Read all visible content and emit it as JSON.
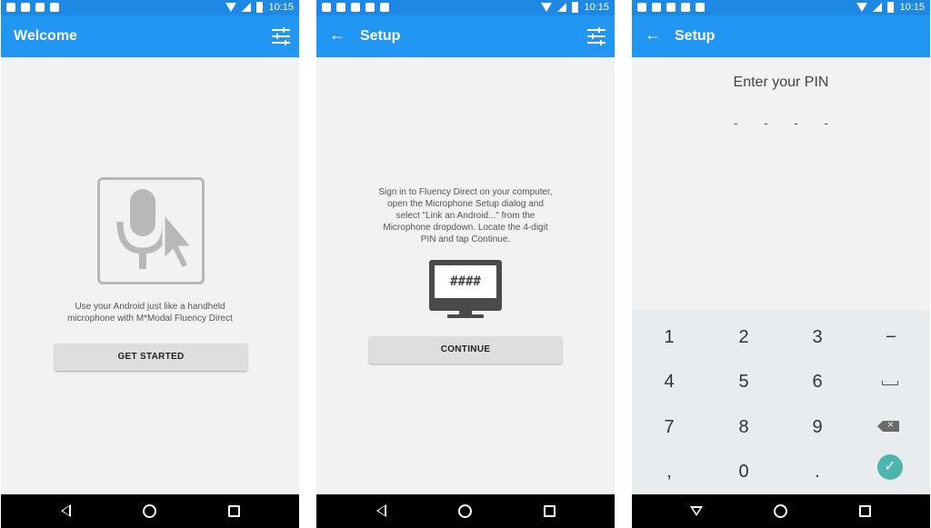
{
  "status_bar": {
    "time": "10:15"
  },
  "screen1": {
    "title": "Welcome",
    "description_line1": "Use your Android just like a handheld",
    "description_line2": "microphone with M*Modal Fluency Direct",
    "button_label": "GET STARTED"
  },
  "screen2": {
    "title": "Setup",
    "back_glyph": "←",
    "instructions": [
      "Sign in to Fluency Direct  on your computer,",
      "open the Microphone Setup dialog and",
      "select \"Link an Android...\" from the",
      "Microphone dropdown. Locate the 4-digit",
      "PIN and tap Continue."
    ],
    "monitor_text": "####",
    "button_label": "CONTINUE"
  },
  "screen3": {
    "title": "Setup",
    "back_glyph": "←",
    "pin_prompt": "Enter your PIN",
    "pin_placeholder": [
      "-",
      "-",
      "-",
      "-"
    ],
    "keys": [
      "1",
      "2",
      "3",
      "−",
      "4",
      "5",
      "6",
      "7",
      "8",
      "9",
      ",",
      "0",
      "."
    ],
    "check_glyph": "✓"
  },
  "icons": {
    "tune": "tune-icon",
    "back": "back-arrow-icon",
    "mic": "microphone-cursor-icon",
    "monitor": "monitor-icon",
    "backspace": "backspace-icon",
    "space": "space-icon",
    "done": "check-icon"
  },
  "colors": {
    "status_bar": "#1e88e5",
    "app_bar": "#2196f3",
    "background": "#f2f2f2",
    "button": "#dedede",
    "keypad": "#e8ecef",
    "accent_check": "#4db6ac"
  }
}
